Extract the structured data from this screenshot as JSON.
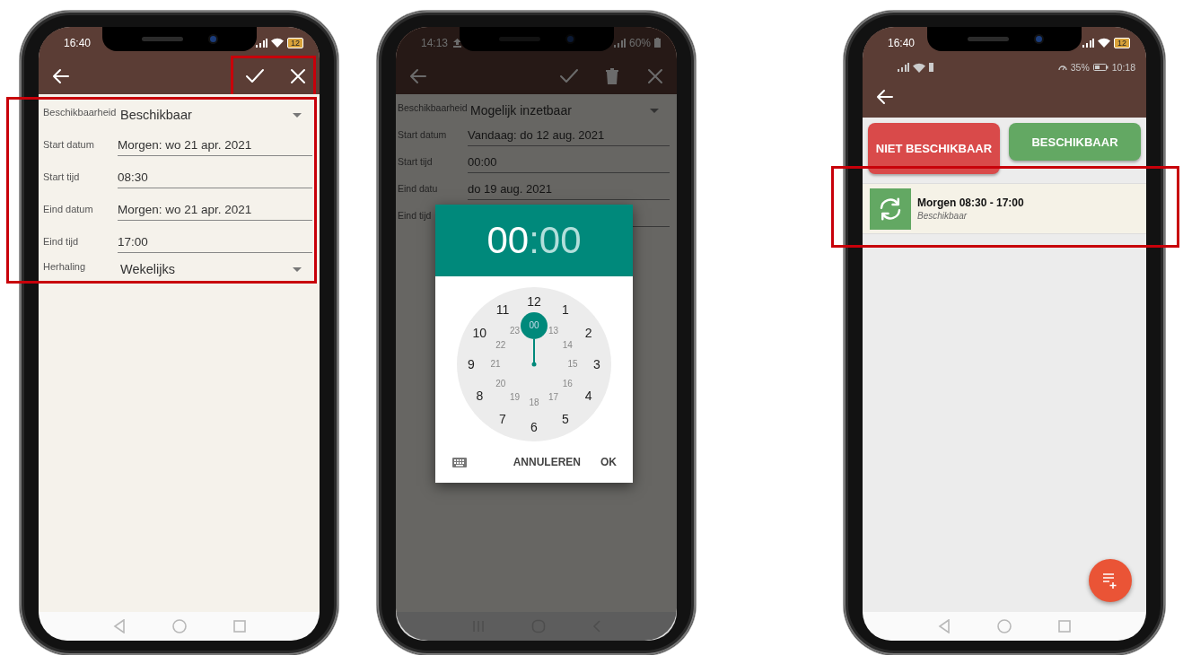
{
  "phones": [
    {
      "kind": "form",
      "dimmed": false,
      "status_bar": {
        "kind": "battery_icon",
        "time": "16:40",
        "battery": "12"
      },
      "toolbar": {
        "highlighted": true,
        "actions": [
          {
            "kind": "check"
          },
          {
            "kind": "close"
          }
        ]
      },
      "form": {
        "highlighted": true,
        "rows": [
          {
            "kind": "dropdown",
            "label": "Beschikbaarheid",
            "value": "Beschikbaar"
          },
          {
            "kind": "text",
            "label": "Start datum",
            "value": "Morgen: wo 21 apr. 2021"
          },
          {
            "kind": "text",
            "label": "Start tijd",
            "value": "08:30"
          },
          {
            "kind": "text",
            "label": "Eind datum",
            "value": "Morgen: wo 21 apr. 2021"
          },
          {
            "kind": "text",
            "label": "Eind tijd",
            "value": "17:00"
          },
          {
            "kind": "dropdown",
            "label": "Herhaling",
            "value": "Wekelijks"
          }
        ]
      },
      "nav_bar": {
        "kind": "standard"
      }
    },
    {
      "kind": "form",
      "dimmed": true,
      "status_bar": {
        "kind": "percent",
        "time": "14:13",
        "battery": "60%"
      },
      "toolbar": {
        "highlighted": false,
        "actions": [
          {
            "kind": "check"
          },
          {
            "kind": "delete"
          },
          {
            "kind": "close"
          }
        ]
      },
      "form": {
        "highlighted": false,
        "rows": [
          {
            "kind": "dropdown",
            "label": "Beschikbaarheid",
            "value": "Mogelijk inzetbaar"
          },
          {
            "kind": "text",
            "label": "Start datum",
            "value": "Vandaag: do 12 aug. 2021"
          },
          {
            "kind": "text",
            "label": "Start tijd",
            "value": "00:00"
          },
          {
            "kind": "text",
            "label": "Eind datu",
            "value": "do 19 aug. 2021"
          },
          {
            "kind": "text",
            "label": "Eind tijd"
          }
        ]
      },
      "time_picker": {
        "hours": {
          "text": "00",
          "selected": true
        },
        "separator": ":",
        "minutes": {
          "text": "00",
          "selected": false
        },
        "outer": [
          {
            "label": "12",
            "selected": false
          },
          {
            "label": "1",
            "selected": false
          },
          {
            "label": "2",
            "selected": false
          },
          {
            "label": "3",
            "selected": false
          },
          {
            "label": "4",
            "selected": false
          },
          {
            "label": "5",
            "selected": false
          },
          {
            "label": "6",
            "selected": false
          },
          {
            "label": "7",
            "selected": false
          },
          {
            "label": "8",
            "selected": false
          },
          {
            "label": "9",
            "selected": false
          },
          {
            "label": "10",
            "selected": false
          },
          {
            "label": "11",
            "selected": false
          }
        ],
        "inner": [
          {
            "label": "00",
            "selected": true
          },
          {
            "label": "13",
            "selected": false
          },
          {
            "label": "14",
            "selected": false
          },
          {
            "label": "15",
            "selected": false
          },
          {
            "label": "16",
            "selected": false
          },
          {
            "label": "17",
            "selected": false
          },
          {
            "label": "18",
            "selected": false
          },
          {
            "label": "19",
            "selected": false
          },
          {
            "label": "20",
            "selected": false
          },
          {
            "label": "21",
            "selected": false
          },
          {
            "label": "22",
            "selected": false
          },
          {
            "label": "23",
            "selected": false
          }
        ],
        "buttons": [
          "ANNULEREN",
          "OK"
        ]
      },
      "nav_bar": {
        "kind": "samsung"
      }
    },
    {
      "kind": "list",
      "dimmed": false,
      "status_bar": {
        "kind": "battery_icon",
        "time": "16:40",
        "battery": "12"
      },
      "inner_status": {
        "battery": "35%",
        "time": "10:18"
      },
      "buttons": [
        {
          "label": "NIET BESCHIKBAAR",
          "color": "#d94a4a"
        },
        {
          "label": "BESCHIKBAAR",
          "color": "#63a863"
        }
      ],
      "items": [
        {
          "title": "Morgen 08:30 - 17:00",
          "subtitle": "Beschikbaar",
          "highlighted": true
        }
      ],
      "nav_bar": {
        "kind": "standard"
      }
    }
  ]
}
